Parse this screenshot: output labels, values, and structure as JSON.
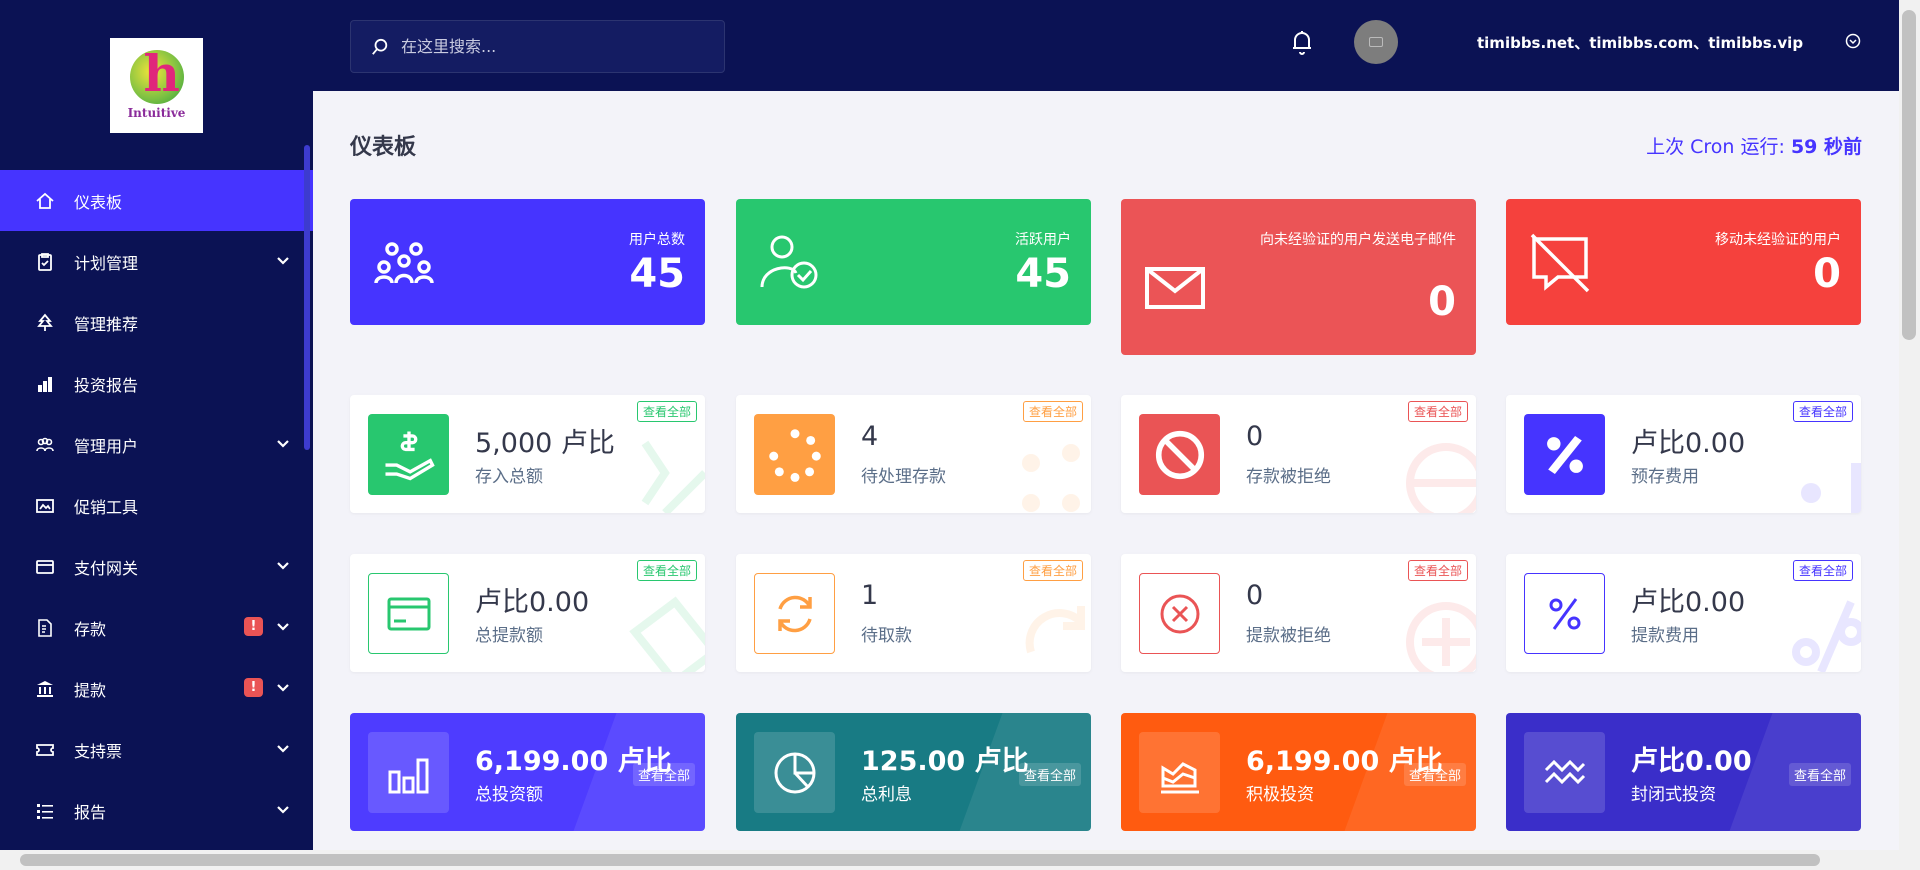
{
  "logo": {
    "text": "Intuitive"
  },
  "search": {
    "placeholder": "在这里搜索..."
  },
  "header": {
    "user": "timibbs.net、timibbs.com、timibbs.vip"
  },
  "page": {
    "title": "仪表板",
    "cron_label": "上次 Cron 运行:",
    "cron_value": "59 秒前"
  },
  "sidebar": {
    "items": [
      {
        "label": "仪表板",
        "icon": "home-icon",
        "active": true
      },
      {
        "label": "计划管理",
        "icon": "clipboard-icon",
        "dropdown": true
      },
      {
        "label": "管理推荐",
        "icon": "tree-icon"
      },
      {
        "label": "投资报告",
        "icon": "bar-chart-icon"
      },
      {
        "label": "管理用户",
        "icon": "users-icon",
        "dropdown": true
      },
      {
        "label": "促销工具",
        "icon": "image-icon"
      },
      {
        "label": "支付网关",
        "icon": "credit-card-icon",
        "dropdown": true
      },
      {
        "label": "存款",
        "icon": "file-dollar-icon",
        "dropdown": true,
        "badge": "!"
      },
      {
        "label": "提款",
        "icon": "bank-icon",
        "dropdown": true,
        "badge": "!"
      },
      {
        "label": "支持票",
        "icon": "ticket-icon",
        "dropdown": true
      },
      {
        "label": "报告",
        "icon": "list-icon",
        "dropdown": true
      }
    ]
  },
  "big_cards": [
    {
      "label": "用户总数",
      "value": "45",
      "color": "#4634ff",
      "icon": "users-group-icon"
    },
    {
      "label": "活跃用户",
      "value": "45",
      "color": "#28c76f",
      "icon": "user-check-icon"
    },
    {
      "label": "向未经验证的用户发送电子邮件",
      "value": "0",
      "color": "#eb5456",
      "icon": "envelope-icon"
    },
    {
      "label": "移动未经验证的用户",
      "value": "0",
      "color": "#f5413d",
      "icon": "message-slash-icon"
    }
  ],
  "view_all": "查看全部",
  "widgets_row1": [
    {
      "value": "5,000 卢比",
      "label": "存入总额",
      "color": "#28c76f",
      "icon": "hand-dollar-icon"
    },
    {
      "value": "4",
      "label": "待处理存款",
      "color": "#ff9f43",
      "icon": "spinner-icon"
    },
    {
      "value": "0",
      "label": "存款被拒绝",
      "color": "#ea5455",
      "icon": "ban-icon"
    },
    {
      "value": "卢比0.00",
      "label": "预存费用",
      "color": "#4634ff",
      "icon": "percent-icon"
    }
  ],
  "widgets_row2": [
    {
      "value": "卢比0.00",
      "label": "总提款额",
      "color": "#28c76f",
      "icon": "credit-card-icon"
    },
    {
      "value": "1",
      "label": "待取款",
      "color": "#ff9f43",
      "icon": "sync-icon"
    },
    {
      "value": "0",
      "label": "提款被拒绝",
      "color": "#ea5455",
      "icon": "times-circle-icon"
    },
    {
      "value": "卢比0.00",
      "label": "提款费用",
      "color": "#4634ff",
      "icon": "percent-icon"
    }
  ],
  "widgets_row3": [
    {
      "value": "6,199.00 卢比",
      "label": "总投资额",
      "color": "#4e3cff",
      "icon": "chart-bar-icon"
    },
    {
      "value": "125.00 卢比",
      "label": "总利息",
      "color": "#187b84",
      "icon": "chart-pie-icon"
    },
    {
      "value": "6,199.00 卢比",
      "label": "积极投资",
      "color": "#ff5b10",
      "icon": "chart-area-icon"
    },
    {
      "value": "卢比0.00",
      "label": "封闭式投资",
      "color": "#3a2ec9",
      "icon": "wave-icon"
    }
  ]
}
